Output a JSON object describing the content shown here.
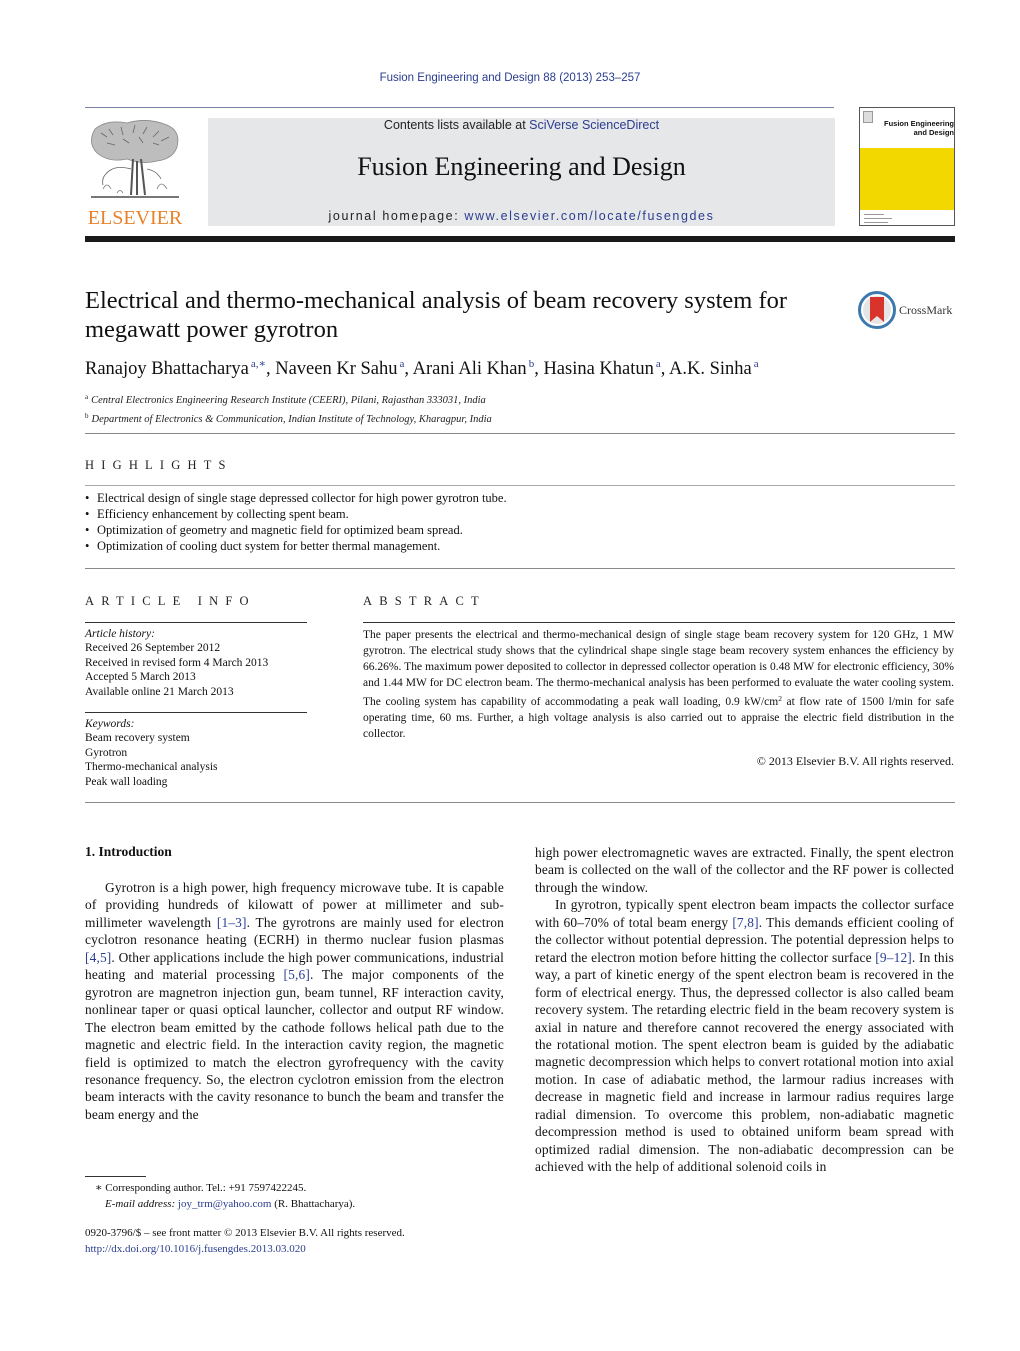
{
  "running_head": "Fusion Engineering and Design 88 (2013) 253–257",
  "masthead": {
    "publisher_logo_text": "ELSEVIER",
    "contents_prefix": "Contents lists available at ",
    "contents_link": "SciVerse ScienceDirect",
    "journal_title": "Fusion Engineering and Design",
    "homepage_prefix": "journal homepage: ",
    "homepage_link": "www.elsevier.com/locate/fusengdes",
    "cover_title_line1": "Fusion Engineering",
    "cover_title_line2": "and Design",
    "colors": {
      "link": "#2a3d8f",
      "elsevier_orange": "#e8822a",
      "cover_yellow": "#f3d800",
      "masthead_bg": "#e6e7e9"
    }
  },
  "article": {
    "title": "Electrical and thermo-mechanical analysis of beam recovery system for megawatt power gyrotron",
    "crossmark_label": "CrossMark",
    "authors": [
      {
        "name": "Ranajoy Bhattacharya",
        "sup": "a,∗"
      },
      {
        "name": "Naveen Kr Sahu",
        "sup": "a"
      },
      {
        "name": "Arani Ali Khan",
        "sup": "b"
      },
      {
        "name": "Hasina Khatun",
        "sup": "a"
      },
      {
        "name": "A.K. Sinha",
        "sup": "a"
      }
    ],
    "affiliations": [
      {
        "key": "a",
        "text": "Central Electronics Engineering Research Institute (CEERI), Pilani, Rajasthan 333031, India"
      },
      {
        "key": "b",
        "text": "Department of Electronics & Communication, Indian Institute of Technology, Kharagpur, India"
      }
    ]
  },
  "highlights": {
    "heading": "HIGHLIGHTS",
    "items": [
      "Electrical design of single stage depressed collector for high power gyrotron tube.",
      "Efficiency enhancement by collecting spent beam.",
      "Optimization of geometry and magnetic field for optimized beam spread.",
      "Optimization of cooling duct system for better thermal management."
    ]
  },
  "article_info": {
    "heading": "ARTICLE INFO",
    "history_label": "Article history:",
    "history": [
      "Received 26 September 2012",
      "Received in revised form 4 March 2013",
      "Accepted 5 March 2013",
      "Available online 21 March 2013"
    ],
    "keywords_label": "Keywords:",
    "keywords": [
      "Beam recovery system",
      "Gyrotron",
      "Thermo-mechanical analysis",
      "Peak wall loading"
    ]
  },
  "abstract": {
    "heading": "ABSTRACT",
    "text_part1": "The paper presents the electrical and thermo-mechanical design of single stage beam recovery system for 120 GHz, 1 MW gyrotron. The electrical study shows that the cylindrical shape single stage beam recovery system enhances the efficiency by 66.26%. The maximum power deposited to collector in depressed collector operation is 0.48 MW for electronic efficiency, 30% and 1.44 MW for DC electron beam. The thermo-mechanical analysis has been performed to evaluate the water cooling system. The cooling system has capability of accommodating a peak wall loading, 0.9 kW/cm",
    "text_sup": "2",
    "text_part2": " at flow rate of 1500 l/min for safe operating time, 60 ms. Further, a high voltage analysis is also carried out to appraise the electric field distribution in the collector.",
    "copyright": "© 2013 Elsevier B.V. All rights reserved."
  },
  "introduction": {
    "heading": "1.  Introduction",
    "col1_para1": [
      {
        "t": "Gyrotron is a high power, high frequency microwave tube. It is capable of providing hundreds of kilowatt of power at millimeter and sub-millimeter wavelength "
      },
      {
        "ref": "[1–3]"
      },
      {
        "t": ". The gyrotrons are mainly used for electron cyclotron resonance heating (ECRH) in thermo nuclear fusion plasmas "
      },
      {
        "ref": "[4,5]"
      },
      {
        "t": ". Other applications include the high power communications, industrial heating and material processing "
      },
      {
        "ref": "[5,6]"
      },
      {
        "t": ". The major components of the gyrotron are magnetron injection gun, beam tunnel, RF interaction cavity, nonlinear taper or quasi optical launcher, collector and output RF window. The electron beam emitted by the cathode follows helical path due to the magnetic and electric field. In the interaction cavity region, the magnetic field is optimized to match the electron gyrofrequency with the cavity resonance frequency. So, the electron cyclotron emission from the electron beam interacts with the cavity resonance to bunch the beam and transfer the beam energy and the"
      }
    ],
    "col2_para1": "high power electromagnetic waves are extracted. Finally, the spent electron beam is collected on the wall of the collector and the RF power is collected through the window.",
    "col2_para2": [
      {
        "t": "In gyrotron, typically spent electron beam impacts the collector surface with 60–70% of total beam energy "
      },
      {
        "ref": "[7,8]"
      },
      {
        "t": ". This demands efficient cooling of the collector without potential depression. The potential depression helps to retard the electron motion before hitting the collector surface "
      },
      {
        "ref": "[9–12]"
      },
      {
        "t": ". In this way, a part of kinetic energy of the spent electron beam is recovered in the form of electrical energy. Thus, the depressed collector is also called beam recovery system. The retarding electric field in the beam recovery system is axial in nature and therefore cannot recovered the energy associated with the rotational motion. The spent electron beam is guided by the adiabatic magnetic decompression which helps to convert rotational motion into axial motion. In case of adiabatic method, the larmour radius increases with decrease in magnetic field and increase in larmour radius requires large radial dimension. To overcome this problem, non-adiabatic magnetic decompression method is used to obtained uniform beam spread with optimized radial dimension. The non-adiabatic decompression can be achieved with the help of additional solenoid coils in"
      }
    ]
  },
  "footnotes": {
    "corresponding": "∗  Corresponding author. Tel.: +91 7597422245.",
    "email_label": "E-mail address: ",
    "email": "joy_trm@yahoo.com",
    "email_suffix": " (R. Bhattacharya).",
    "issn": "0920-3796/$ – see front matter © 2013 Elsevier B.V. All rights reserved.",
    "doi": "http://dx.doi.org/10.1016/j.fusengdes.2013.03.020"
  }
}
